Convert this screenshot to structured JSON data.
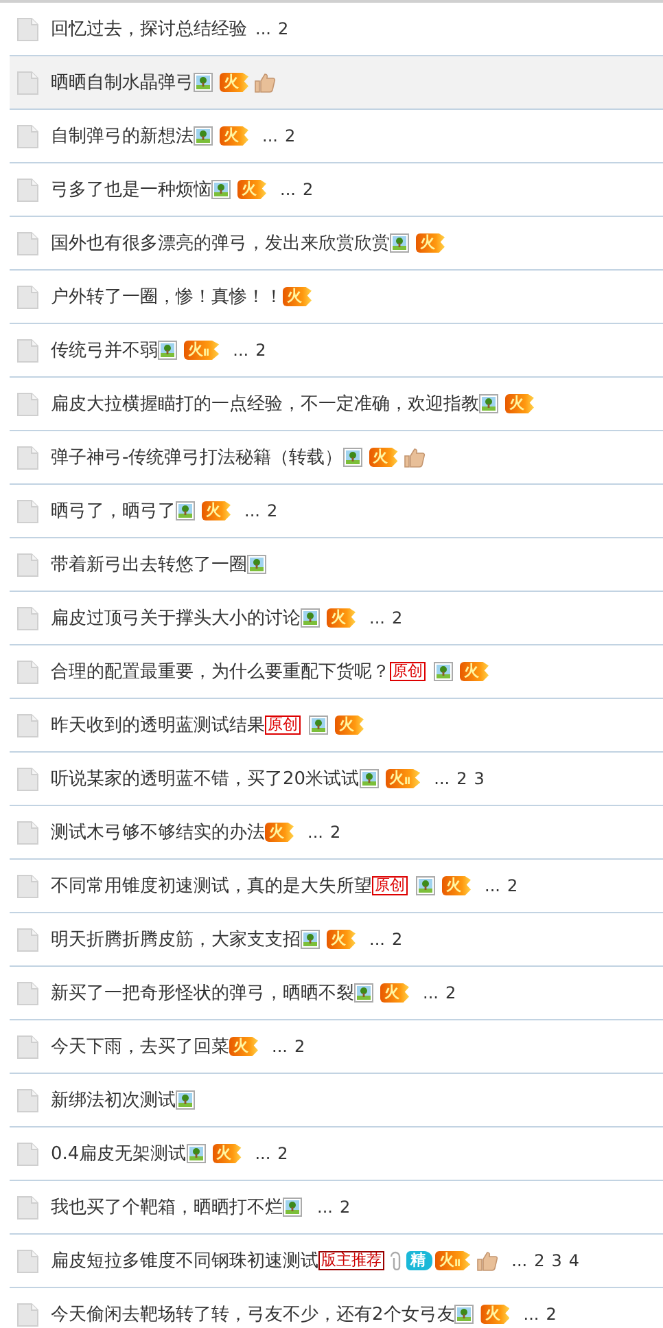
{
  "threads": [
    {
      "title": "回忆过去，探讨总结经验",
      "selected": false,
      "more": "...",
      "pages": [
        "2"
      ]
    },
    {
      "title": "晒晒自制水晶弹弓",
      "selected": true,
      "tags": [
        {
          "kind": "photo"
        },
        {
          "kind": "hot",
          "text": "火"
        },
        {
          "kind": "thumb"
        }
      ]
    },
    {
      "title": "自制弹弓的新想法",
      "selected": false,
      "tags": [
        {
          "kind": "photo"
        },
        {
          "kind": "hot",
          "text": "火"
        }
      ],
      "more": "...",
      "pages": [
        "2"
      ]
    },
    {
      "title": "弓多了也是一种烦恼",
      "selected": false,
      "tags": [
        {
          "kind": "photo"
        },
        {
          "kind": "hot",
          "text": "火"
        }
      ],
      "more": "...",
      "pages": [
        "2"
      ]
    },
    {
      "title": "国外也有很多漂亮的弹弓，发出来欣赏欣赏",
      "selected": false,
      "tags": [
        {
          "kind": "photo"
        },
        {
          "kind": "hot",
          "text": "火"
        }
      ]
    },
    {
      "title": "户外转了一圈，惨！真惨！！",
      "selected": false,
      "tags": [
        {
          "kind": "hot",
          "text": "火"
        }
      ]
    },
    {
      "title": "传统弓并不弱",
      "selected": false,
      "tags": [
        {
          "kind": "photo"
        },
        {
          "kind": "hot",
          "text": "火",
          "sub": "Ⅱ"
        }
      ],
      "more": "...",
      "pages": [
        "2"
      ]
    },
    {
      "title": "扁皮大拉横握瞄打的一点经验，不一定准确，欢迎指教",
      "selected": false,
      "tags": [
        {
          "kind": "photo"
        },
        {
          "kind": "hot",
          "text": "火"
        }
      ]
    },
    {
      "title": "弹子神弓-传统弹弓打法秘籍（转载）",
      "selected": false,
      "tags": [
        {
          "kind": "photo"
        },
        {
          "kind": "hot",
          "text": "火"
        },
        {
          "kind": "thumb"
        }
      ]
    },
    {
      "title": "晒弓了，晒弓了",
      "selected": false,
      "tags": [
        {
          "kind": "photo"
        },
        {
          "kind": "hot",
          "text": "火"
        }
      ],
      "more": "...",
      "pages": [
        "2"
      ]
    },
    {
      "title": "带着新弓出去转悠了一圈",
      "selected": false,
      "tags": [
        {
          "kind": "photo"
        }
      ]
    },
    {
      "title": "扁皮过顶弓关于撑头大小的讨论",
      "selected": false,
      "tags": [
        {
          "kind": "photo"
        },
        {
          "kind": "hot",
          "text": "火"
        }
      ],
      "more": "...",
      "pages": [
        "2"
      ]
    },
    {
      "title": "合理的配置最重要，为什么要重配下货呢？",
      "selected": false,
      "tags": [
        {
          "kind": "original",
          "text": "原创"
        },
        {
          "kind": "photo"
        },
        {
          "kind": "hot",
          "text": "火"
        }
      ]
    },
    {
      "title": "昨天收到的透明蓝测试结果",
      "selected": false,
      "tags": [
        {
          "kind": "original",
          "text": "原创"
        },
        {
          "kind": "photo"
        },
        {
          "kind": "hot",
          "text": "火"
        }
      ]
    },
    {
      "title": "听说某家的透明蓝不错，买了20米试试",
      "selected": false,
      "tags": [
        {
          "kind": "photo"
        },
        {
          "kind": "hot",
          "text": "火",
          "sub": "Ⅱ"
        }
      ],
      "more": "...",
      "pages": [
        "2",
        "3"
      ]
    },
    {
      "title": "测试木弓够不够结实的办法",
      "selected": false,
      "tags": [
        {
          "kind": "hot",
          "text": "火"
        }
      ],
      "more": "...",
      "pages": [
        "2"
      ]
    },
    {
      "title": "不同常用锥度初速测试，真的是大失所望",
      "selected": false,
      "tags": [
        {
          "kind": "original",
          "text": "原创"
        },
        {
          "kind": "photo"
        },
        {
          "kind": "hot",
          "text": "火"
        }
      ],
      "more": "...",
      "pages": [
        "2"
      ]
    },
    {
      "title": "明天折腾折腾皮筋，大家支支招",
      "selected": false,
      "tags": [
        {
          "kind": "photo"
        },
        {
          "kind": "hot",
          "text": "火"
        }
      ],
      "more": "...",
      "pages": [
        "2"
      ]
    },
    {
      "title": "新买了一把奇形怪状的弹弓，晒晒不裂",
      "selected": false,
      "tags": [
        {
          "kind": "photo"
        },
        {
          "kind": "hot",
          "text": "火"
        }
      ],
      "more": "...",
      "pages": [
        "2"
      ]
    },
    {
      "title": "今天下雨，去买了回菜",
      "selected": false,
      "tags": [
        {
          "kind": "hot",
          "text": "火"
        }
      ],
      "more": "...",
      "pages": [
        "2"
      ]
    },
    {
      "title": "新绑法初次测试",
      "selected": false,
      "tags": [
        {
          "kind": "photo"
        }
      ]
    },
    {
      "title": "0.4扁皮无架测试",
      "selected": false,
      "tags": [
        {
          "kind": "photo"
        },
        {
          "kind": "hot",
          "text": "火"
        }
      ],
      "more": "...",
      "pages": [
        "2"
      ]
    },
    {
      "title": "我也买了个靶箱，晒晒打不烂",
      "selected": false,
      "tags": [
        {
          "kind": "photo"
        }
      ],
      "more": "...",
      "pages": [
        "2"
      ]
    },
    {
      "title": "扁皮短拉多锥度不同钢珠初速测试",
      "selected": false,
      "tags": [
        {
          "kind": "pick",
          "text": "版主推荐"
        },
        {
          "kind": "attach"
        },
        {
          "kind": "digest",
          "text": "精"
        },
        {
          "kind": "hot",
          "text": "火",
          "sub": "Ⅱ"
        },
        {
          "kind": "thumb"
        }
      ],
      "more": "...",
      "pages": [
        "2",
        "3",
        "4"
      ]
    },
    {
      "title": "今天偷闲去靶场转了转，弓友不少，还有2个女弓友",
      "selected": false,
      "tags": [
        {
          "kind": "photo"
        },
        {
          "kind": "hot",
          "text": "火"
        }
      ],
      "more": "...",
      "pages": [
        "2"
      ]
    }
  ]
}
